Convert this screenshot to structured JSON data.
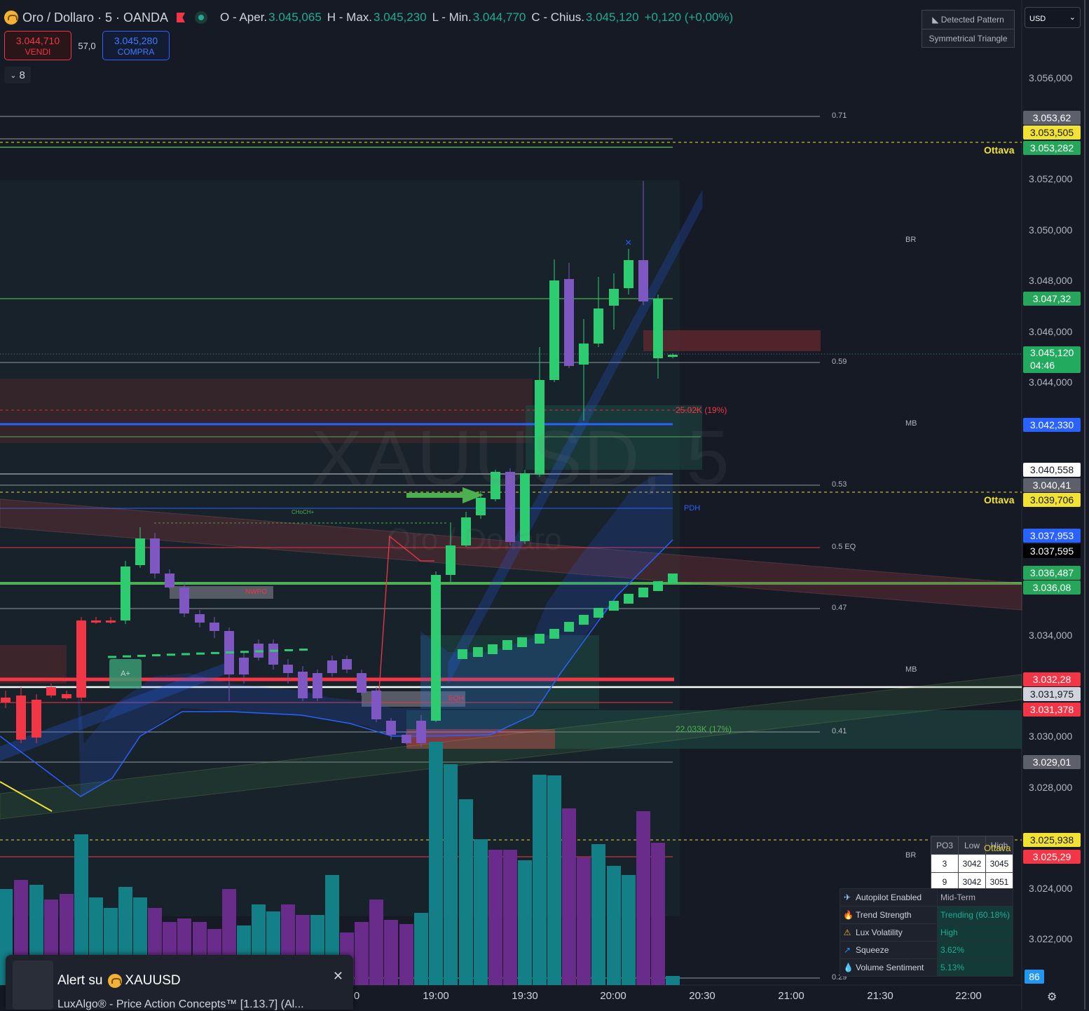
{
  "header": {
    "symbol": "Oro / Dollaro · 5 · OANDA",
    "open_label": "O - Aper.",
    "open": "3.045,065",
    "high_label": "H - Max.",
    "high": "3.045,230",
    "low_label": "L - Min.",
    "low": "3.044,770",
    "close_label": "C - Chius.",
    "close": "3.045,120",
    "change": "+0,120 (+0,00%)"
  },
  "trade": {
    "sell_price": "3.044,710",
    "sell_label": "VENDI",
    "spread": "57,0",
    "buy_price": "3.045,280",
    "buy_label": "COMPRA"
  },
  "indicators_count": "8",
  "pattern": {
    "title": "Detected Pattern",
    "name": "Symmetrical Triangle"
  },
  "currency": "USD",
  "watermark": {
    "symbol": "XAUUSD, 5",
    "name": "Oro / Dollaro"
  },
  "price_axis": [
    "3.056,000",
    "3.052,000",
    "3.050,000",
    "3.048,000",
    "3.046,000",
    "3.044,000",
    "3.034,000",
    "3.030,000",
    "3.028,000",
    "3.024,000",
    "3.022,000"
  ],
  "price_labels": [
    {
      "text": "3.053,62",
      "bg": "#5d606b",
      "fg": "#ffffff"
    },
    {
      "text": "3.053,505",
      "bg": "#f2e233",
      "fg": "#131722"
    },
    {
      "text": "3.053,282",
      "bg": "#26a65b",
      "fg": "#ffffff"
    },
    {
      "text": "3.047,32",
      "bg": "#26a65b",
      "fg": "#ffffff"
    },
    {
      "text": "3.045,120",
      "bg": "#22ab5f",
      "fg": "#ffffff",
      "sub": "04:46"
    },
    {
      "text": "3.042,330",
      "bg": "#2962ff",
      "fg": "#ffffff"
    },
    {
      "text": "3.040,558",
      "bg": "#ffffff",
      "fg": "#131722"
    },
    {
      "text": "3.040,41",
      "bg": "#5d606b",
      "fg": "#ffffff"
    },
    {
      "text": "3.039,706",
      "bg": "#f2e233",
      "fg": "#131722"
    },
    {
      "text": "3.037,953",
      "bg": "#2962ff",
      "fg": "#ffffff"
    },
    {
      "text": "3.037,595",
      "bg": "#000000",
      "fg": "#ffffff"
    },
    {
      "text": "3.036,487",
      "bg": "#26a65b",
      "fg": "#ffffff"
    },
    {
      "text": "3.036,08",
      "bg": "#26a65b",
      "fg": "#ffffff"
    },
    {
      "text": "3.032,28",
      "bg": "#f23645",
      "fg": "#ffffff"
    },
    {
      "text": "3.031,975",
      "bg": "#d1d4dc",
      "fg": "#131722"
    },
    {
      "text": "3.031,378",
      "bg": "#f23645",
      "fg": "#ffffff"
    },
    {
      "text": "3.029,01",
      "bg": "#5d606b",
      "fg": "#ffffff"
    },
    {
      "text": "3.025,938",
      "bg": "#f2e233",
      "fg": "#131722"
    },
    {
      "text": "3.025,29",
      "bg": "#f23645",
      "fg": "#ffffff"
    },
    {
      "text": "86",
      "bg": "#2196f3",
      "fg": "#ffffff"
    }
  ],
  "ottava_label": "Ottava",
  "levels": {
    "l071": "0.71",
    "l059": "0.59",
    "l053": "0.53",
    "l05": "0.5 EQ",
    "l047": "0.47",
    "l041": "0.41",
    "l029": "0.29",
    "br": "BR",
    "mb": "MB",
    "pdh": "PDH",
    "choch": "CHoCH+",
    "vol_top": "25.02K (19%)",
    "vol_bot": "22.033K (17%)",
    "nwpo": "NWPO",
    "eqh": "EQH",
    "alert_tag": "A+"
  },
  "time_axis": [
    "0",
    "19:00",
    "19:30",
    "20:00",
    "20:30",
    "21:00",
    "21:30",
    "22:00"
  ],
  "po_table": {
    "headers": [
      "PO3",
      "Low",
      "High"
    ],
    "rows": [
      [
        "3",
        "3042",
        "3045"
      ],
      [
        "9",
        "3042",
        "3051"
      ]
    ],
    "overlay": "Ottava"
  },
  "autopilot": [
    {
      "icon": "✈",
      "label": "Autopilot Enabled",
      "value": "Mid-Term"
    },
    {
      "icon": "🔥",
      "label": "Trend Strength",
      "value": "Trending (60.18%)"
    },
    {
      "icon": "⚠",
      "label": "Lux Volatility",
      "value": "High"
    },
    {
      "icon": "↗",
      "label": "Squeeze",
      "value": "3.62%"
    },
    {
      "icon": "💧",
      "label": "Volume Sentiment",
      "value": "5.13%"
    }
  ],
  "alert": {
    "prefix": "Alert su",
    "symbol": "XAUUSD",
    "text": "LuxAlgo® - Price Action Concepts™ [1.13.7] (Al..."
  },
  "colors": {
    "bull": "#2ecc71",
    "bear": "#7e57c2",
    "red": "#f23645",
    "blue": "#2962ff",
    "volume_teal": "#137f87",
    "volume_purple": "#6a2c8a"
  }
}
